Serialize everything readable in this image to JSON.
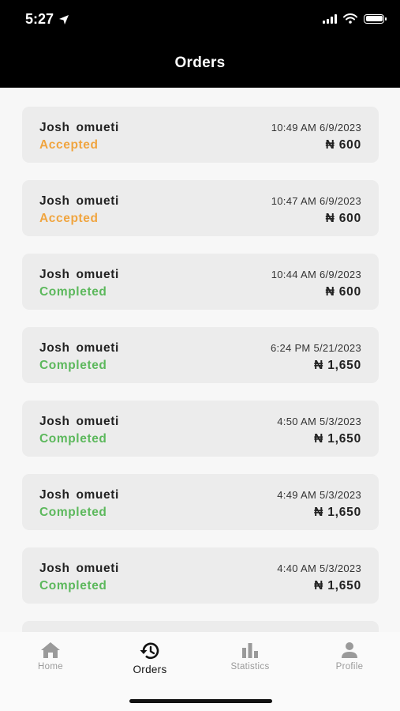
{
  "status_bar": {
    "time": "5:27"
  },
  "header": {
    "title": "Orders"
  },
  "colors": {
    "accepted": "#f0a540",
    "completed": "#5cb85c"
  },
  "orders": [
    {
      "name": "Josh  omueti",
      "status": "Accepted",
      "datetime": "10:49 AM 6/9/2023",
      "amount": "₦ 600"
    },
    {
      "name": "Josh  omueti",
      "status": "Accepted",
      "datetime": "10:47 AM 6/9/2023",
      "amount": "₦ 600"
    },
    {
      "name": "Josh  omueti",
      "status": "Completed",
      "datetime": "10:44 AM 6/9/2023",
      "amount": "₦ 600"
    },
    {
      "name": "Josh  omueti",
      "status": "Completed",
      "datetime": "6:24 PM 5/21/2023",
      "amount": "₦ 1,650"
    },
    {
      "name": "Josh  omueti",
      "status": "Completed",
      "datetime": "4:50 AM 5/3/2023",
      "amount": "₦ 1,650"
    },
    {
      "name": "Josh  omueti",
      "status": "Completed",
      "datetime": "4:49 AM 5/3/2023",
      "amount": "₦ 1,650"
    },
    {
      "name": "Josh  omueti",
      "status": "Completed",
      "datetime": "4:40 AM 5/3/2023",
      "amount": "₦ 1,650"
    }
  ],
  "tabs": [
    {
      "label": "Home",
      "icon": "home-icon"
    },
    {
      "label": "Orders",
      "icon": "history-icon"
    },
    {
      "label": "Statistics",
      "icon": "bar-chart-icon"
    },
    {
      "label": "Profile",
      "icon": "person-icon"
    }
  ],
  "active_tab": 1
}
